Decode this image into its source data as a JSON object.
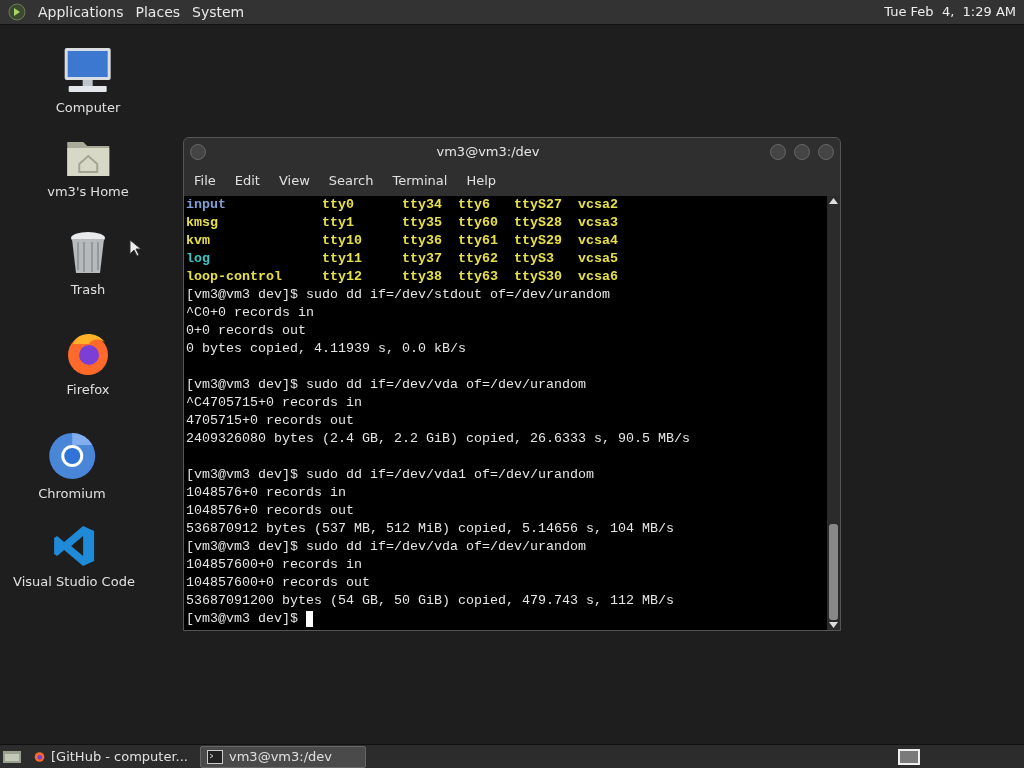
{
  "top_panel": {
    "menus": [
      "Applications",
      "Places",
      "System"
    ],
    "clock": "Tue Feb  4,  1:29 AM"
  },
  "desktop_icons": [
    {
      "kind": "computer",
      "label": "Computer"
    },
    {
      "kind": "home",
      "label": "vm3's Home"
    },
    {
      "kind": "trash",
      "label": "Trash"
    },
    {
      "kind": "firefox",
      "label": "Firefox"
    },
    {
      "kind": "chromium",
      "label": "Chromium"
    },
    {
      "kind": "vscode",
      "label": "Visual Studio Code"
    }
  ],
  "terminal": {
    "title": "vm3@vm3:/dev",
    "menu": [
      "File",
      "Edit",
      "View",
      "Search",
      "Terminal",
      "Help"
    ],
    "listing": [
      [
        {
          "text": "input",
          "kind": "dir"
        },
        {
          "text": "tty0",
          "kind": "device"
        },
        {
          "text": "tty34",
          "kind": "device"
        },
        {
          "text": "tty6",
          "kind": "device"
        },
        {
          "text": "ttyS27",
          "kind": "device"
        },
        {
          "text": "vcsa2",
          "kind": "device"
        }
      ],
      [
        {
          "text": "kmsg",
          "kind": "device"
        },
        {
          "text": "tty1",
          "kind": "device"
        },
        {
          "text": "tty35",
          "kind": "device"
        },
        {
          "text": "tty60",
          "kind": "device"
        },
        {
          "text": "ttyS28",
          "kind": "device"
        },
        {
          "text": "vcsa3",
          "kind": "device"
        }
      ],
      [
        {
          "text": "kvm",
          "kind": "device"
        },
        {
          "text": "tty10",
          "kind": "device"
        },
        {
          "text": "tty36",
          "kind": "device"
        },
        {
          "text": "tty61",
          "kind": "device"
        },
        {
          "text": "ttyS29",
          "kind": "device"
        },
        {
          "text": "vcsa4",
          "kind": "device"
        }
      ],
      [
        {
          "text": "log",
          "kind": "link"
        },
        {
          "text": "tty11",
          "kind": "device"
        },
        {
          "text": "tty37",
          "kind": "device"
        },
        {
          "text": "tty62",
          "kind": "device"
        },
        {
          "text": "ttyS3",
          "kind": "device"
        },
        {
          "text": "vcsa5",
          "kind": "device"
        }
      ],
      [
        {
          "text": "loop-control",
          "kind": "device"
        },
        {
          "text": "tty12",
          "kind": "device"
        },
        {
          "text": "tty38",
          "kind": "device"
        },
        {
          "text": "tty63",
          "kind": "device"
        },
        {
          "text": "ttyS30",
          "kind": "device"
        },
        {
          "text": "vcsa6",
          "kind": "device"
        }
      ]
    ],
    "lines": [
      {
        "kind": "text",
        "text": "[vm3@vm3 dev]$ sudo dd if=/dev/stdout of=/dev/urandom"
      },
      {
        "kind": "text",
        "text": "^C0+0 records in"
      },
      {
        "kind": "text",
        "text": "0+0 records out"
      },
      {
        "kind": "text",
        "text": "0 bytes copied, 4.11939 s, 0.0 kB/s"
      },
      {
        "kind": "blank"
      },
      {
        "kind": "text",
        "text": "[vm3@vm3 dev]$ sudo dd if=/dev/vda of=/dev/urandom"
      },
      {
        "kind": "text",
        "text": "^C4705715+0 records in"
      },
      {
        "kind": "text",
        "text": "4705715+0 records out"
      },
      {
        "kind": "text",
        "text": "2409326080 bytes (2.4 GB, 2.2 GiB) copied, 26.6333 s, 90.5 MB/s"
      },
      {
        "kind": "blank"
      },
      {
        "kind": "text",
        "text": "[vm3@vm3 dev]$ sudo dd if=/dev/vda1 of=/dev/urandom"
      },
      {
        "kind": "text",
        "text": "1048576+0 records in"
      },
      {
        "kind": "text",
        "text": "1048576+0 records out"
      },
      {
        "kind": "text",
        "text": "536870912 bytes (537 MB, 512 MiB) copied, 5.14656 s, 104 MB/s"
      },
      {
        "kind": "text",
        "text": "[vm3@vm3 dev]$ sudo dd if=/dev/vda of=/dev/urandom"
      },
      {
        "kind": "text",
        "text": "104857600+0 records in"
      },
      {
        "kind": "text",
        "text": "104857600+0 records out"
      },
      {
        "kind": "text",
        "text": "53687091200 bytes (54 GB, 50 GiB) copied, 479.743 s, 112 MB/s"
      },
      {
        "kind": "prompt",
        "text": "[vm3@vm3 dev]$",
        "cursor": true
      }
    ]
  },
  "taskbar": {
    "items": [
      {
        "kind": "browser",
        "label": "[GitHub - computer...",
        "selected": false
      },
      {
        "kind": "terminal",
        "label": "vm3@vm3:/dev",
        "selected": true
      }
    ]
  }
}
